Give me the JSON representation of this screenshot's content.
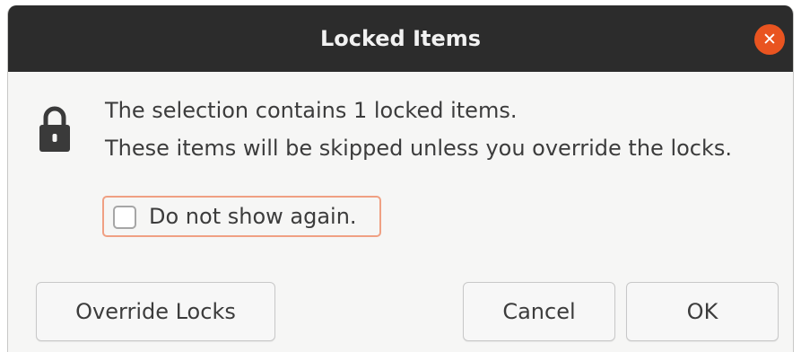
{
  "dialog": {
    "title": "Locked Items",
    "close_glyph": "✕",
    "icon": "lock-icon",
    "message_lines": [
      "The selection contains 1 locked items.",
      "These items will be skipped unless you override the locks."
    ],
    "checkbox": {
      "label": "Do not show again.",
      "checked": false
    },
    "buttons": {
      "override": "Override Locks",
      "cancel": "Cancel",
      "ok": "OK"
    }
  },
  "colors": {
    "titlebar": "#2c2c2c",
    "close_button": "#e95420",
    "focus_outline": "#f0a083",
    "text": "#3c3c3c"
  }
}
